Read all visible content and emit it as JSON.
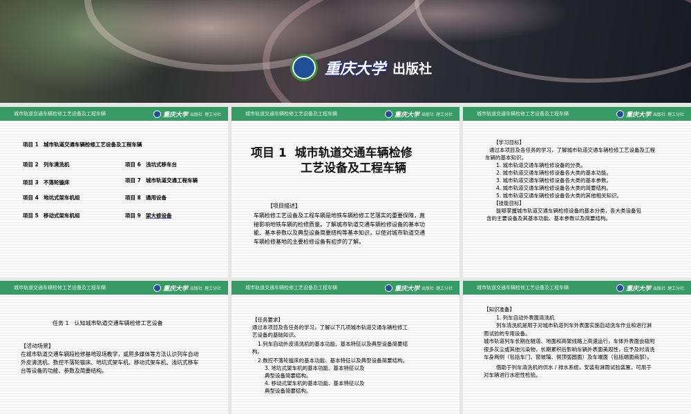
{
  "banner": {
    "publisher_script": "重庆大学",
    "publisher_suffix": "出版社"
  },
  "header": {
    "title": "城市轨道交通车辆检修工艺设备及工程车辆",
    "logo_script": "重庆大学",
    "logo_sub": "出版社",
    "branch": "理工分社"
  },
  "slide1": {
    "items": [
      {
        "num": "项目 1",
        "name": "城市轨道交通车辆检修工艺设备及工程车辆"
      },
      {
        "num": "项目 2",
        "name": "列车清洗机"
      },
      {
        "num": "项目 3",
        "name": "不落轮镟床"
      },
      {
        "num": "项目 4",
        "name": "地坑式架车机组"
      },
      {
        "num": "项目 5",
        "name": "移动式架车机组"
      },
      {
        "num": "项目 6",
        "name": "浅坑式移车台"
      },
      {
        "num": "项目 7",
        "name": "城市轨道交通工程车辆"
      },
      {
        "num": "项目 8",
        "name": "通用设备"
      },
      {
        "num": "项目 9",
        "name": "架大修设备"
      }
    ]
  },
  "slide2": {
    "title_num": "项目 1",
    "title_line1": "城市轨道交通车辆检修",
    "title_line2": "工艺设备及工程车辆",
    "section": "【项目描述】",
    "text": "车辆检修工艺设备及工程车辆是地铁车辆检修工艺落实的重要保障，直接影响地铁车辆的检修质量。了解城市轨道交通车辆检修设备的基本功能、基本参数以及典型设备简要结构等基本知识，以使对城市轨道交通车辆检修基地的主要检修设备有初步的了解。"
  },
  "slide3": {
    "section1": "【学习目标】",
    "intro": "通过本项目及各任务的学习，了解城市轨道交通车辆检修工艺设备及工程车辆的基本知识。",
    "goals": [
      "1. 城市轨道交通车辆检修设备的分类。",
      "2. 城市轨道交通车辆检修设备各大类的基本功能。",
      "3. 城市轨道交通车辆检修设备各大类的基本参数。",
      "4. 城市轨道交通车辆检修设备各大类的简要结构。",
      "5. 城市轨道交通车辆检修设备各大类的其他相关知识。"
    ],
    "section2": "【技能目标】",
    "skill1": "能够掌握城市轨道交通车辆检修设备的基本分类，各大类设备包",
    "skill2": "含的主要设备及其基本功能、基本参数以及简要结构。"
  },
  "slide4": {
    "task": "任务 1　认知城市轨道交通车辆检修工艺设备",
    "section": "【活动场景】",
    "text": "在城市轨道交通车辆段检修基地现场教学，或用多媒体等方法认识列车自动外皮清洗机、数控不落轮镟床、地坑式架车机、移动式架车机、浅坑式移车台等设备的功能、参数及简要结构。"
  },
  "slide5": {
    "section": "【任务要求】",
    "intro": "通过本项目及各任务的学习，了解以下几项城市轨道交通车辆检修工艺设备的基础知识。",
    "reqs": [
      "1.列车自动外皮清洗机的基本功能、基本特征以及典型设备简要结构。",
      "2.数控不落轮镟床的基本功能、基本特征以及典型设备简要结构。",
      "3. 地坑式架车机的基本功能、基本特征以及典型设备简要结构。",
      "4. 移动式架车机的基本功能、基本特征以及典型设备简要结构。"
    ]
  },
  "slide6": {
    "section": "【知识准备】",
    "sub": "1. 列车自动外表面清洗机",
    "p1": "列车清洗机是用于对城市轨道列车外表面实施自动洗车作业和进行淋雨试验的专用设备。",
    "p2": "城市轨道列车长期在隧道、地面和高架线路上高速运行，车体外表面会吸附很多灰尘或其他污染物，长期累积后影响车辆外表面美观性，应予及时清洗车身两侧（包括车门、窗玻璃、侧顶弧圆面）及车端面（包括端面肩部）。",
    "p3": "借助于列车清洗机的供水 / 排水系统，安装有淋雨试验装置，可用于对车辆进行水密性检验。"
  }
}
